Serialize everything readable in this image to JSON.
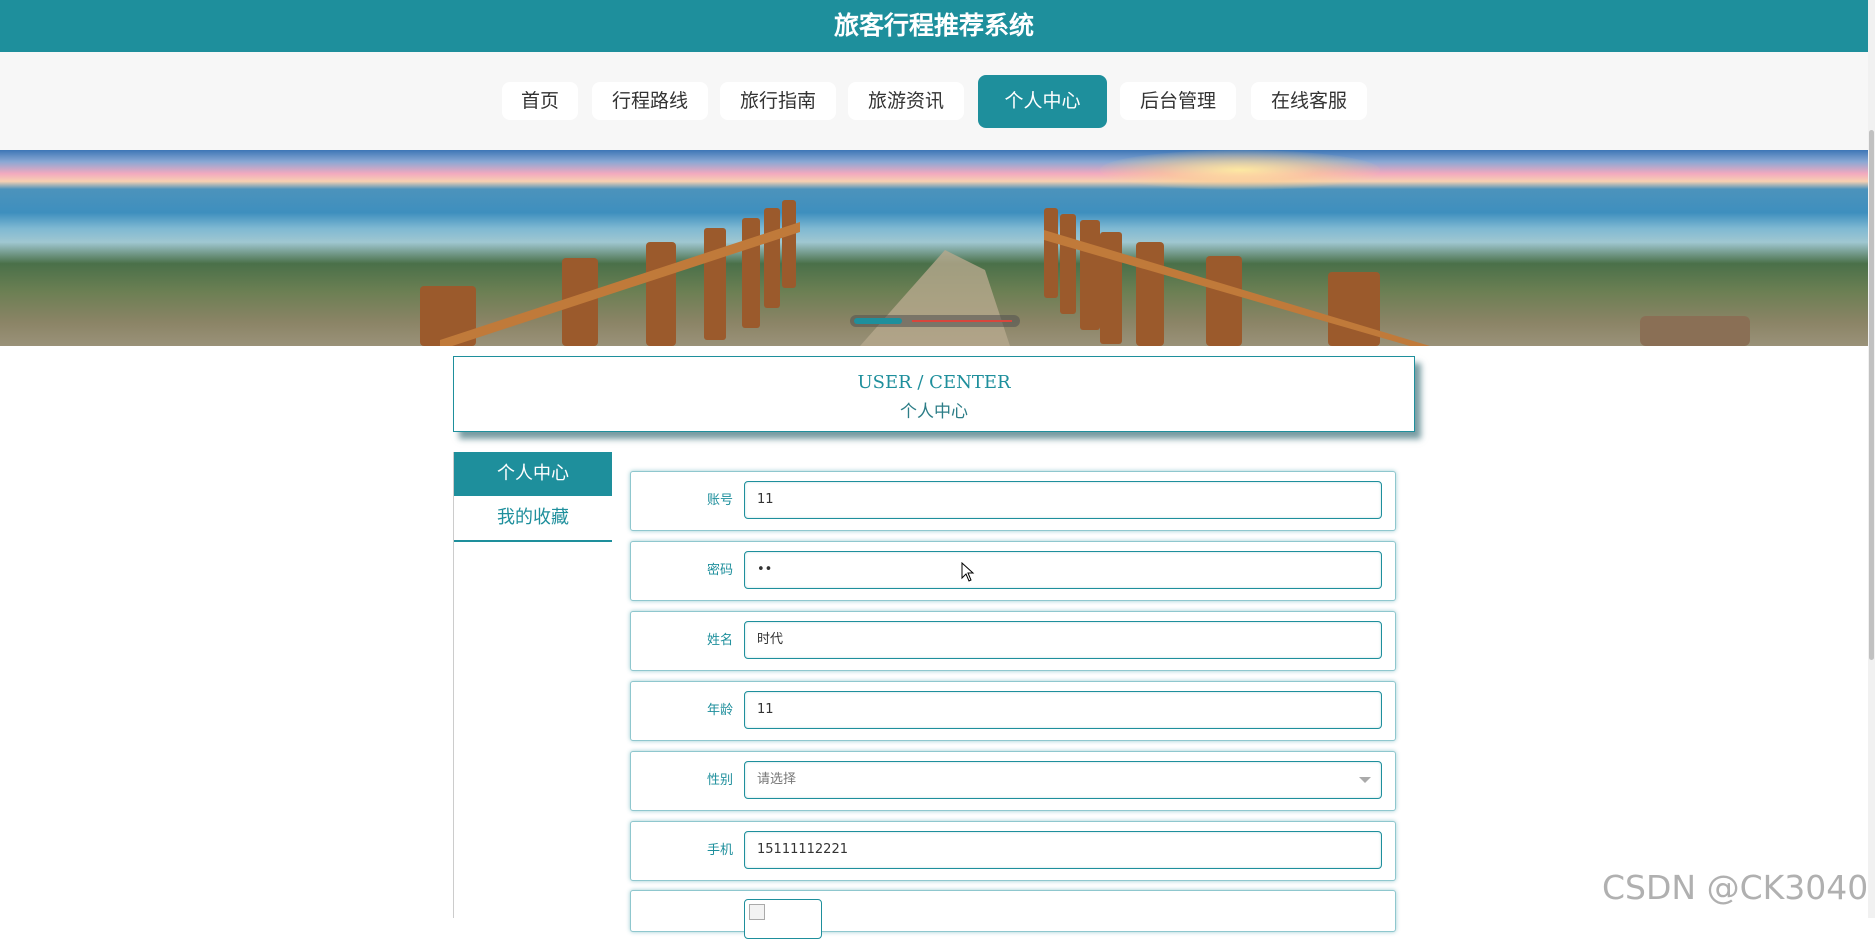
{
  "site_title": "旅客行程推荐系统",
  "nav": [
    {
      "label": "首页",
      "active": false
    },
    {
      "label": "行程路线",
      "active": false
    },
    {
      "label": "旅行指南",
      "active": false
    },
    {
      "label": "旅游资讯",
      "active": false
    },
    {
      "label": "个人中心",
      "active": true
    },
    {
      "label": "后台管理",
      "active": false
    },
    {
      "label": "在线客服",
      "active": false
    }
  ],
  "center_header": {
    "en": "USER / CENTER",
    "cn": "个人中心"
  },
  "sidebar": {
    "items": [
      {
        "label": "个人中心",
        "active": true
      },
      {
        "label": "我的收藏",
        "active": false
      }
    ]
  },
  "form": {
    "fields": [
      {
        "label": "账号",
        "value": "11"
      },
      {
        "label": "密码",
        "value": "••"
      },
      {
        "label": "姓名",
        "value": "时代"
      },
      {
        "label": "年龄",
        "value": "11"
      },
      {
        "label": "性别",
        "placeholder": "请选择",
        "value": ""
      },
      {
        "label": "手机",
        "value": "15111112221"
      }
    ]
  },
  "watermark": "CSDN @CK3040",
  "colors": {
    "primary": "#1e8f9c",
    "nav_bg": "#f7f7f7"
  },
  "icons": {
    "cursor": "mouse-pointer-icon",
    "caret": "chevron-down-icon"
  }
}
